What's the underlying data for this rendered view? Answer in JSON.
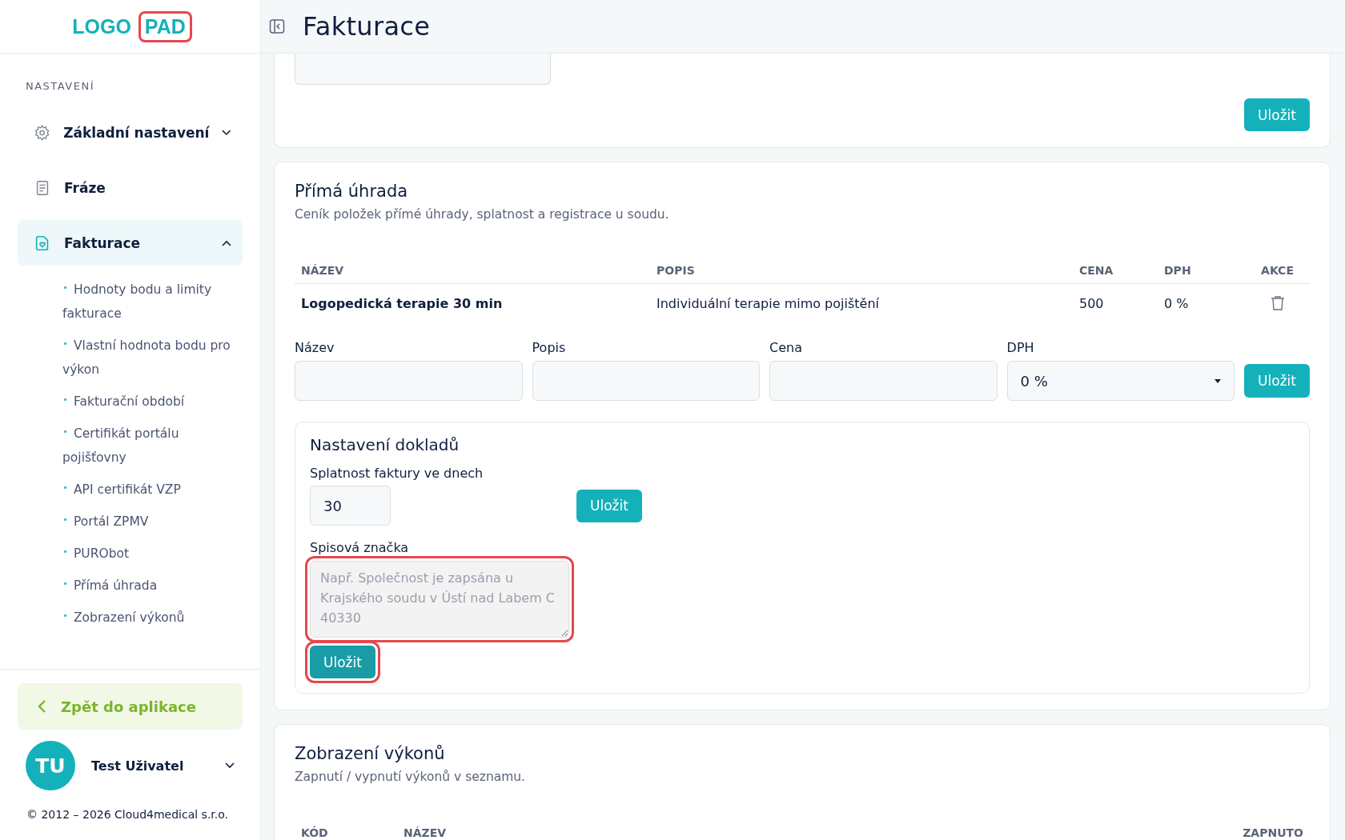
{
  "logo": {
    "parts": [
      "LOGO",
      "PAD"
    ],
    "highlighted": true
  },
  "header": {
    "title": "Fakturace"
  },
  "sidebar": {
    "section": "NASTAVENÍ",
    "items": [
      {
        "label": "Základní nastavení",
        "expanded": false,
        "selected": false
      },
      {
        "label": "Fráze",
        "selected": false
      },
      {
        "label": "Fakturace",
        "expanded": true,
        "selected": true,
        "children": [
          {
            "label": "Hodnoty bodu a limity fakturace"
          },
          {
            "label": "Vlastní hodnota bodu pro výkon"
          },
          {
            "label": "Fakturační období"
          },
          {
            "label": "Certifikát portálu pojišťovny"
          },
          {
            "label": "API certifikát VZP"
          },
          {
            "label": "Portál ZPMV"
          },
          {
            "label": "PURObot"
          },
          {
            "label": "Přímá úhrada"
          },
          {
            "label": "Zobrazení výkonů"
          }
        ]
      }
    ],
    "back": "Zpět do aplikace",
    "user": {
      "initials": "TU",
      "name": "Test Uživatel"
    },
    "copyright": "© 2012 – 2026 Cloud4medical s.r.o."
  },
  "top_card": {
    "button": "Uložit"
  },
  "direct_payment": {
    "title": "Přímá úhrada",
    "subtitle": "Ceník položek přímé úhrady, splatnost a registrace u soudu.",
    "columns": [
      "NÁZEV",
      "POPIS",
      "CENA",
      "DPH",
      "AKCE"
    ],
    "rows": [
      {
        "name": "Logopedická terapie 30 min",
        "description": "Individuální terapie mimo pojištění",
        "price": "500",
        "vat": "0 %"
      }
    ],
    "form": {
      "fields": [
        {
          "label": "Název",
          "kind": "text"
        },
        {
          "label": "Popis",
          "kind": "text"
        },
        {
          "label": "Cena",
          "kind": "text"
        },
        {
          "label": "DPH",
          "kind": "select",
          "value": "0 %"
        }
      ],
      "button": "Uložit"
    },
    "documents": {
      "title": "Nastavení dokladů",
      "due_label": "Splatnost faktury ve dnech",
      "due_value": "30",
      "due_button": "Uložit",
      "ref_label": "Spisová značka",
      "ref_placeholder": "Např. Společnost je zapsána u Krajského soudu v Ústí nad Labem C 40330",
      "ref_highlighted": true,
      "ref_button": "Uložit",
      "ref_button_highlighted": true
    }
  },
  "services": {
    "title": "Zobrazení výkonů",
    "subtitle": "Zapnutí / vypnutí výkonů v seznamu.",
    "columns": [
      "KÓD",
      "NÁZEV",
      "ZAPNUTO"
    ]
  }
}
